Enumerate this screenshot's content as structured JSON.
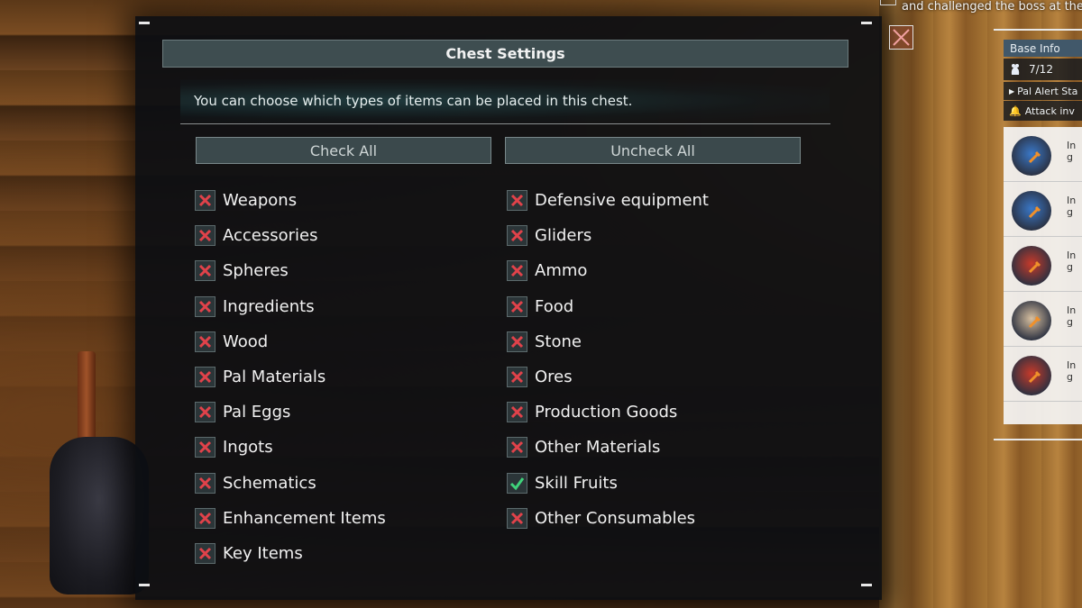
{
  "dialog": {
    "title": "Chest Settings",
    "subtitle": "You can choose which types of items can be placed in this chest.",
    "check_all": "Check All",
    "uncheck_all": "Uncheck All"
  },
  "left_items": [
    {
      "label": "Weapons",
      "checked": false
    },
    {
      "label": "Accessories",
      "checked": false
    },
    {
      "label": "Spheres",
      "checked": false
    },
    {
      "label": "Ingredients",
      "checked": false
    },
    {
      "label": "Wood",
      "checked": false
    },
    {
      "label": "Pal Materials",
      "checked": false
    },
    {
      "label": "Pal Eggs",
      "checked": false
    },
    {
      "label": "Ingots",
      "checked": false
    },
    {
      "label": "Schematics",
      "checked": false
    },
    {
      "label": "Enhancement Items",
      "checked": false
    },
    {
      "label": "Key Items",
      "checked": false
    }
  ],
  "right_items": [
    {
      "label": "Defensive equipment",
      "checked": false
    },
    {
      "label": "Gliders",
      "checked": false
    },
    {
      "label": "Ammo",
      "checked": false
    },
    {
      "label": "Food",
      "checked": false
    },
    {
      "label": "Stone",
      "checked": false
    },
    {
      "label": "Ores",
      "checked": false
    },
    {
      "label": "Production Goods",
      "checked": false
    },
    {
      "label": "Other Materials",
      "checked": false
    },
    {
      "label": "Skill Fruits",
      "checked": true
    },
    {
      "label": "Other Consumables",
      "checked": false
    }
  ],
  "hud": {
    "quest_text": "and challenged the boss at the",
    "base_info_label": "Base Info",
    "pal_count": "7/12",
    "pal_alert": "Pal Alert Sta",
    "attack_text": "Attack inv",
    "pals": [
      {
        "status": "In g",
        "color": "#3a78c8"
      },
      {
        "status": "In g",
        "color": "#3a78c8"
      },
      {
        "status": "In g",
        "color": "#c83a2a"
      },
      {
        "status": "In g",
        "color": "#d8c0a0"
      },
      {
        "status": "In g",
        "color": "#c83a2a"
      }
    ]
  },
  "colors": {
    "checked": "#3fd27a",
    "unchecked": "#e0424a"
  }
}
